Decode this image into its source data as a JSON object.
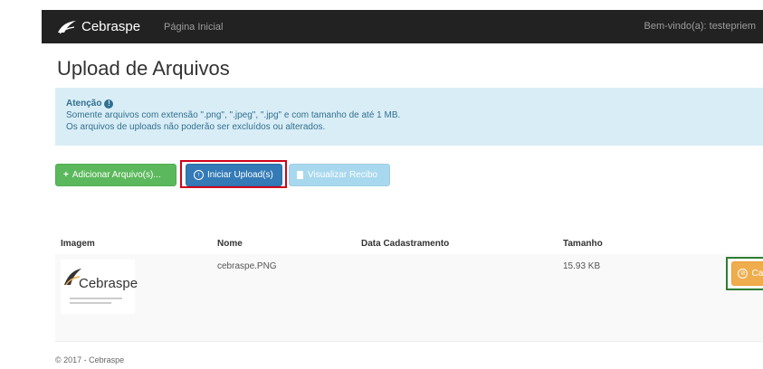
{
  "navbar": {
    "brand": "Cebraspe",
    "home_link": "Página Inicial",
    "user": "Bem-vindo(a): testepriem"
  },
  "page": {
    "title": "Upload de Arquivos"
  },
  "alert": {
    "title": "Atenção",
    "line1": "Somente arquivos com extensão \".png\", \".jpeg\", \".jpg\" e com tamanho de até 1 MB.",
    "line2": "Os arquivos de uploads não poderão ser excluídos ou alterados."
  },
  "toolbar": {
    "add_label": "Adicionar Arquivo(s)...",
    "upload_label": "Iniciar Upload(s)",
    "receipt_label": "Visualizar Recibo"
  },
  "table": {
    "headers": [
      "Imagem",
      "Nome",
      "Data Cadastramento",
      "Tamanho"
    ],
    "rows": [
      {
        "thumbnail_text": "Cebraspe",
        "name": "cebraspe.PNG",
        "date": "",
        "size": "15.93 KB",
        "action": "Cancelar"
      }
    ]
  },
  "footer": {
    "text": "© 2017 - Cebraspe"
  },
  "colors": {
    "navbar": "#222222",
    "alert_bg": "#d9edf7",
    "add": "#5cb85c",
    "upload": "#337ab7",
    "receipt": "#a8d8ee",
    "cancel": "#f0ad4e",
    "highlight_red": "#d0021b",
    "highlight_green": "#2e7d32"
  }
}
